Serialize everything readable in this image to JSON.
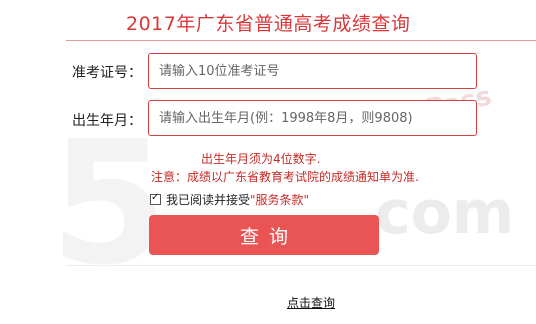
{
  "header": {
    "title": "2017年广东省普通高考成绩查询"
  },
  "form": {
    "id_label": "准考证号：",
    "id_placeholder": "请输入10位准考证号",
    "birth_label": "出生年月：",
    "birth_placeholder": "请输入出生年月(例：1998年8月，则9808)",
    "hint": "出生年月须为4位数字.",
    "note": "注意：成绩以广东省教育考试院的成绩通知单为准.",
    "agree_prefix": "我已阅读并接受",
    "agree_terms": "\"服务条款\"",
    "submit_label": "查询"
  },
  "footer": {
    "link_label": "点击查询"
  },
  "watermark": {
    "glyph": "5",
    "suffix": "com",
    "tag": "Pass"
  },
  "colors": {
    "accent": "#d9383a",
    "button": "#e85554",
    "error": "#c62b26"
  }
}
